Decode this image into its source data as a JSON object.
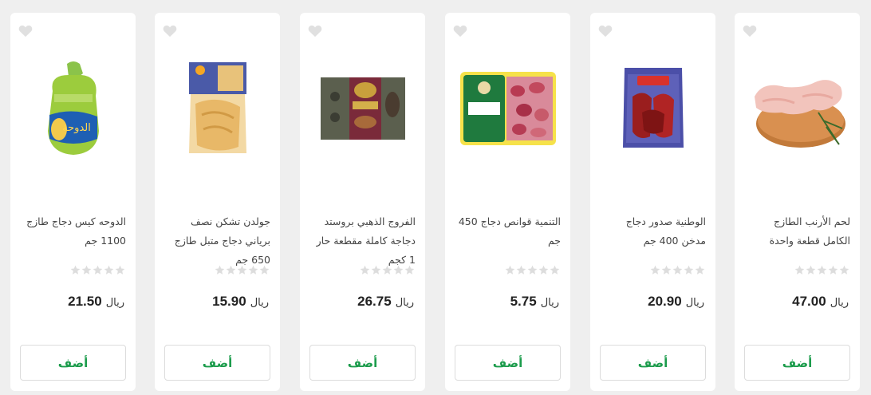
{
  "currency_label": "ريال",
  "add_label": "أضف",
  "colors": {
    "accent": "#1c9c4c",
    "star_empty": "#dddddd",
    "heart_empty": "#e0e0e0"
  },
  "products": [
    {
      "title": "الدوحه كيس دجاج طازج 1100 جم",
      "price": "21.50",
      "rating": 0,
      "image_icon": "whole-chicken-bag-icon"
    },
    {
      "title": "جولدن تشكن نصف برياني دجاج متبل طازج 650 جم",
      "price": "15.90",
      "rating": 0,
      "image_icon": "marinated-chicken-tray-icon"
    },
    {
      "title": "الفروج الذهبي بروستد دجاجة كاملة مقطعة حار 1 كجم",
      "price": "26.75",
      "rating": 0,
      "image_icon": "broasted-chicken-box-icon"
    },
    {
      "title": "التنمية قوانص دجاج 450 جم",
      "price": "5.75",
      "rating": 0,
      "image_icon": "gizzards-tray-icon"
    },
    {
      "title": "الوطنية صدور دجاج مدخن 400 جم",
      "price": "20.90",
      "rating": 0,
      "image_icon": "smoked-chicken-pack-icon"
    },
    {
      "title": "لحم الأرنب الطازج الكامل قطعة واحدة",
      "price": "47.00",
      "rating": 0,
      "image_icon": "rabbit-meat-icon"
    }
  ]
}
